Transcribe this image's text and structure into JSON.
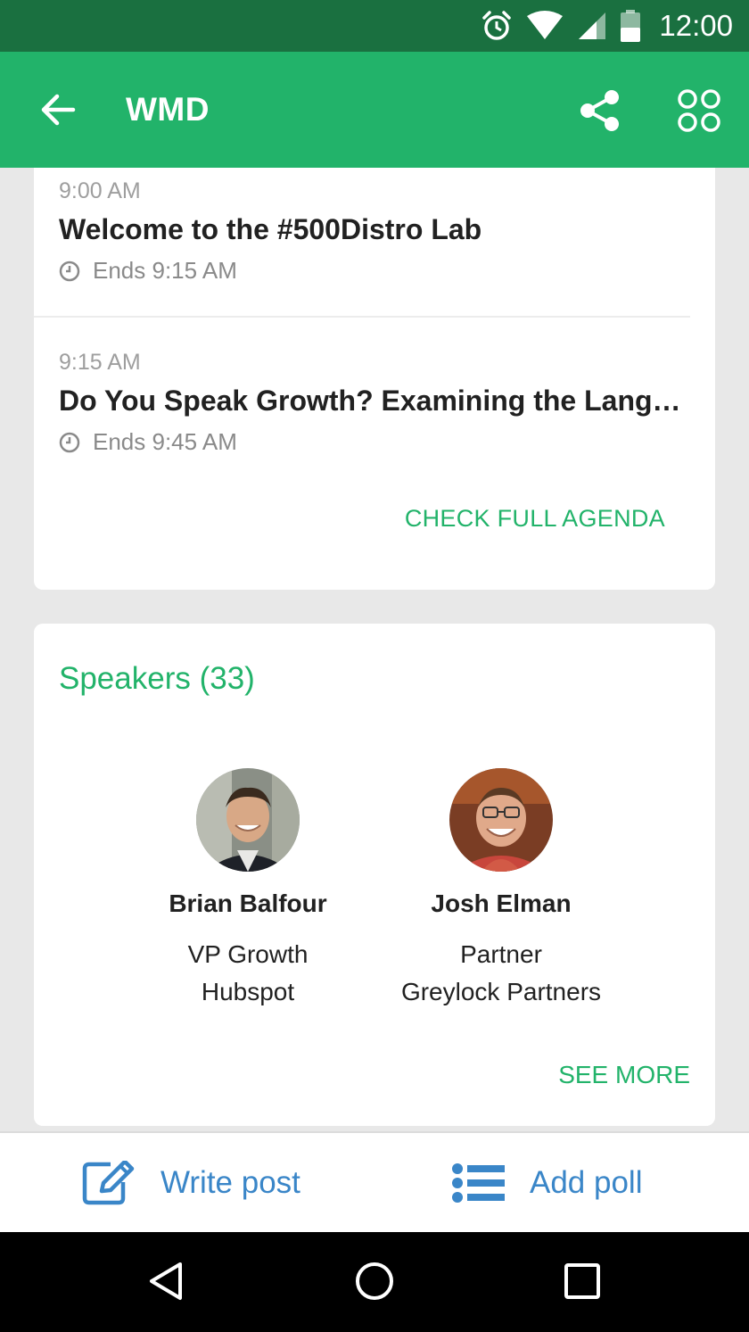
{
  "status_bar": {
    "time": "12:00",
    "icons": [
      "alarm-icon",
      "wifi-icon",
      "signal-icon",
      "battery-icon"
    ]
  },
  "app_bar": {
    "title": "WMD",
    "back_icon": "arrow-left-icon",
    "share_icon": "share-icon",
    "menu_icon": "apps-grid-icon"
  },
  "agenda": {
    "sessions": [
      {
        "time": "9:00 AM",
        "title": "Welcome to the #500Distro Lab",
        "ends": "Ends 9:15 AM"
      },
      {
        "time": "9:15 AM",
        "title": "Do You Speak Growth? Examining the Lang…",
        "ends": "Ends 9:45 AM"
      }
    ],
    "check_full_agenda": "CHECK FULL AGENDA"
  },
  "speakers": {
    "title": "Speakers (33)",
    "items": [
      {
        "name": "Brian Balfour",
        "title": "VP Growth",
        "company": "Hubspot"
      },
      {
        "name": "Josh Elman",
        "title": "Partner",
        "company": "Greylock Partners"
      }
    ],
    "see_more": "SEE MORE"
  },
  "bottom_actions": {
    "write_post": "Write post",
    "add_poll": "Add poll"
  },
  "colors": {
    "status_bar": "#1a7040",
    "app_bar": "#22b36a",
    "accent_green": "#22b36a",
    "action_blue": "#3a86c8",
    "background": "#e8e8e8"
  }
}
